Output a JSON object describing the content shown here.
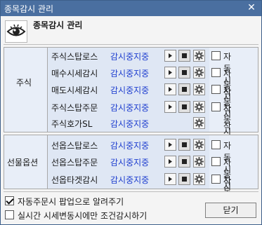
{
  "window": {
    "title": "종목감시 관리",
    "close_glyph": "✕"
  },
  "header": {
    "heading": "종목감시 관리",
    "icon": "eye-icon"
  },
  "groups": [
    {
      "label": "주식",
      "rows": [
        {
          "name": "주식스탑로스",
          "status": "감시중지중",
          "has_play": true,
          "has_stop": true,
          "has_gear": true,
          "checkbox_label": "자동시작"
        },
        {
          "name": "매수시세감시",
          "status": "감시중지중",
          "has_play": true,
          "has_stop": true,
          "has_gear": true,
          "checkbox_label": "자동시작"
        },
        {
          "name": "매도시세감시",
          "status": "감시중지중",
          "has_play": true,
          "has_stop": true,
          "has_gear": true,
          "checkbox_label": "자동시작"
        },
        {
          "name": "주식스탑주문",
          "status": "감시중지중",
          "has_play": true,
          "has_stop": true,
          "has_gear": true,
          "checkbox_label": "자동시작"
        },
        {
          "name": "주식호가SL",
          "status": "감시중지중",
          "has_play": false,
          "has_stop": false,
          "has_gear": true,
          "checkbox_label": ""
        }
      ]
    },
    {
      "label": "선물옵션",
      "rows": [
        {
          "name": "선옵스탑로스",
          "status": "감시중지중",
          "has_play": true,
          "has_stop": true,
          "has_gear": true,
          "checkbox_label": "자동시작"
        },
        {
          "name": "선옵스탑주문",
          "status": "감시중지중",
          "has_play": true,
          "has_stop": true,
          "has_gear": true,
          "checkbox_label": "자동시작"
        },
        {
          "name": "선옵타겟감시",
          "status": "감시중지중",
          "has_play": true,
          "has_stop": true,
          "has_gear": true,
          "checkbox_label": "자동시작"
        }
      ]
    }
  ],
  "options": {
    "popup_label": "자동주문시 팝업으로 알려주기",
    "popup_checked": true,
    "realtime_label": "실시간 시세변동시에만 조건감시하기",
    "realtime_checked": false
  },
  "buttons": {
    "close_label": "닫기"
  },
  "colors": {
    "titlebar": "#4a6fa0",
    "status_text": "#1f3fcf",
    "panel": "#dfe7f4"
  }
}
